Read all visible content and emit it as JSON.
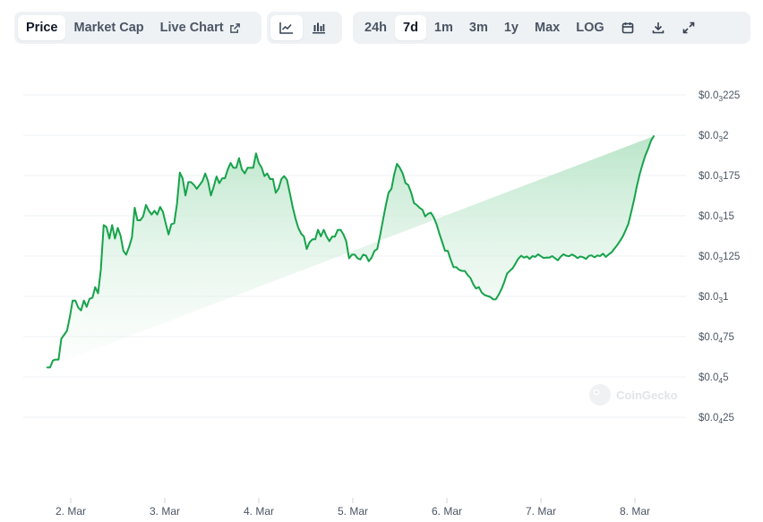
{
  "toolbar": {
    "metric_tabs": [
      {
        "label": "Price",
        "active": true
      },
      {
        "label": "Market Cap",
        "active": false
      },
      {
        "label": "Live Chart",
        "active": false
      }
    ],
    "chart_type_icons": [
      "line-chart-icon",
      "candlestick-chart-icon"
    ],
    "ranges": [
      {
        "label": "24h",
        "active": false
      },
      {
        "label": "7d",
        "active": true
      },
      {
        "label": "1m",
        "active": false
      },
      {
        "label": "3m",
        "active": false
      },
      {
        "label": "1y",
        "active": false
      },
      {
        "label": "Max",
        "active": false
      },
      {
        "label": "LOG",
        "active": false
      }
    ],
    "tool_icons": [
      "calendar-icon",
      "download-icon",
      "expand-icon"
    ]
  },
  "watermark": "CoinGecko",
  "colors": {
    "line": "#16a34a",
    "area_top": "#b7e4c7",
    "volume_bar": "#e5e7eb",
    "grid": "#eef0f3"
  },
  "chart_data": {
    "type": "area",
    "title": "",
    "xlabel": "",
    "ylabel": "",
    "y_ticks": [
      {
        "value": 2.25e-05,
        "prefix": "$0.0",
        "sub": "3",
        "digits": "225"
      },
      {
        "value": 2e-05,
        "prefix": "$0.0",
        "sub": "3",
        "digits": "2"
      },
      {
        "value": 1.75e-05,
        "prefix": "$0.0",
        "sub": "3",
        "digits": "175"
      },
      {
        "value": 1.5e-05,
        "prefix": "$0.0",
        "sub": "3",
        "digits": "15"
      },
      {
        "value": 1.25e-05,
        "prefix": "$0.0",
        "sub": "3",
        "digits": "125"
      },
      {
        "value": 1e-05,
        "prefix": "$0.0",
        "sub": "3",
        "digits": "1"
      },
      {
        "value": 7.5e-06,
        "prefix": "$0.0",
        "sub": "4",
        "digits": "75"
      },
      {
        "value": 5e-06,
        "prefix": "$0.0",
        "sub": "4",
        "digits": "5"
      },
      {
        "value": 2.5e-06,
        "prefix": "$0.0",
        "sub": "4",
        "digits": "25"
      }
    ],
    "ylim": [
      2.5e-06,
      2.25e-05
    ],
    "x_ticks": [
      "2. Mar",
      "3. Mar",
      "4. Mar",
      "5. Mar",
      "6. Mar",
      "7. Mar",
      "8. Mar"
    ],
    "grid": true,
    "price_series": {
      "x_days": [
        1.75,
        1.78,
        1.81,
        1.84,
        1.87,
        1.9,
        1.93,
        1.96,
        1.99,
        2.02,
        2.05,
        2.08,
        2.11,
        2.14,
        2.17,
        2.2,
        2.23,
        2.26,
        2.29,
        2.32,
        2.35,
        2.38,
        2.41,
        2.44,
        2.47,
        2.5,
        2.53,
        2.56,
        2.59,
        2.62,
        2.65,
        2.68,
        2.71,
        2.74,
        2.77,
        2.8,
        2.83,
        2.86,
        2.89,
        2.92,
        2.95,
        2.98,
        3.01,
        3.04,
        3.07,
        3.1,
        3.13,
        3.16,
        3.19,
        3.22,
        3.25,
        3.28,
        3.31,
        3.34,
        3.37,
        3.4,
        3.43,
        3.46,
        3.49,
        3.52,
        3.55,
        3.58,
        3.61,
        3.64,
        3.67,
        3.7,
        3.73,
        3.76,
        3.79,
        3.82,
        3.85,
        3.88,
        3.91,
        3.94,
        3.97,
        4.0,
        4.03,
        4.06,
        4.09,
        4.12,
        4.15,
        4.18,
        4.21,
        4.24,
        4.27,
        4.3,
        4.33,
        4.36,
        4.39,
        4.42,
        4.45,
        4.48,
        4.51,
        4.54,
        4.57,
        4.6,
        4.63,
        4.66,
        4.69,
        4.72,
        4.75,
        4.78,
        4.81,
        4.84,
        4.87,
        4.9,
        4.93,
        4.96,
        4.99,
        5.02,
        5.05,
        5.08,
        5.11,
        5.14,
        5.17,
        5.2,
        5.23,
        5.26,
        5.29,
        5.32,
        5.35,
        5.38,
        5.41,
        5.44,
        5.47,
        5.5,
        5.53,
        5.56,
        5.59,
        5.62,
        5.65,
        5.68,
        5.71,
        5.74,
        5.77,
        5.8,
        5.83,
        5.86,
        5.89,
        5.92,
        5.95,
        5.98,
        6.01,
        6.04,
        6.07,
        6.1,
        6.13,
        6.16,
        6.19,
        6.22,
        6.25,
        6.28,
        6.31,
        6.34,
        6.37,
        6.4,
        6.43,
        6.46,
        6.49,
        6.52,
        6.55,
        6.58,
        6.61,
        6.64,
        6.67,
        6.7,
        6.73,
        6.76,
        6.79,
        6.82,
        6.85,
        6.88,
        6.91,
        6.94,
        6.97,
        7.0,
        7.03,
        7.06,
        7.09,
        7.12,
        7.15,
        7.18,
        7.21,
        7.24,
        7.27,
        7.3,
        7.33,
        7.36,
        7.39,
        7.42,
        7.45,
        7.48,
        7.51,
        7.54,
        7.57,
        7.6,
        7.63,
        7.66,
        7.69,
        7.72,
        7.75,
        7.78,
        7.81,
        7.84,
        7.87,
        7.9,
        7.93,
        7.96,
        7.99,
        8.02,
        8.05,
        8.08,
        8.11,
        8.14,
        8.17,
        8.2,
        8.23,
        8.26,
        8.29,
        8.32,
        8.35,
        8.38,
        8.41,
        8.44,
        8.47,
        8.5
      ],
      "values": [
        5.59e-06,
        5.59e-06,
        6.02e-06,
        6.08e-06,
        6.08e-06,
        7.38e-06,
        7.61e-06,
        7.87e-06,
        8.72e-06,
        9.74e-06,
        9.74e-06,
        9.3e-06,
        9.13e-06,
        9.74e-06,
        9.35e-06,
        9.85e-06,
        9.91e-06,
        1.057e-05,
        1.019e-05,
        1.166e-05,
        1.442e-05,
        1.43e-05,
        1.359e-05,
        1.442e-05,
        1.359e-05,
        1.425e-05,
        1.377e-05,
        1.282e-05,
        1.259e-05,
        1.306e-05,
        1.365e-05,
        1.55e-05,
        1.472e-05,
        1.472e-05,
        1.496e-05,
        1.567e-05,
        1.531e-05,
        1.508e-05,
        1.531e-05,
        1.508e-05,
        1.555e-05,
        1.525e-05,
        1.454e-05,
        1.384e-05,
        1.448e-05,
        1.454e-05,
        1.573e-05,
        1.768e-05,
        1.733e-05,
        1.626e-05,
        1.709e-05,
        1.709e-05,
        1.691e-05,
        1.667e-05,
        1.691e-05,
        1.715e-05,
        1.762e-05,
        1.715e-05,
        1.626e-05,
        1.68e-05,
        1.744e-05,
        1.702e-05,
        1.733e-05,
        1.733e-05,
        1.787e-05,
        1.828e-05,
        1.798e-05,
        1.798e-05,
        1.858e-05,
        1.787e-05,
        1.763e-05,
        1.798e-05,
        1.798e-05,
        1.798e-05,
        1.887e-05,
        1.828e-05,
        1.798e-05,
        1.746e-05,
        1.763e-05,
        1.728e-05,
        1.728e-05,
        1.643e-05,
        1.669e-05,
        1.728e-05,
        1.746e-05,
        1.722e-05,
        1.639e-05,
        1.555e-05,
        1.484e-05,
        1.425e-05,
        1.389e-05,
        1.371e-05,
        1.294e-05,
        1.336e-05,
        1.354e-05,
        1.354e-05,
        1.413e-05,
        1.372e-05,
        1.413e-05,
        1.372e-05,
        1.342e-05,
        1.371e-05,
        1.371e-05,
        1.413e-05,
        1.413e-05,
        1.384e-05,
        1.342e-05,
        1.236e-05,
        1.259e-05,
        1.259e-05,
        1.236e-05,
        1.229e-05,
        1.259e-05,
        1.253e-05,
        1.218e-05,
        1.241e-05,
        1.282e-05,
        1.294e-05,
        1.377e-05,
        1.472e-05,
        1.561e-05,
        1.644e-05,
        1.667e-05,
        1.757e-05,
        1.822e-05,
        1.798e-05,
        1.762e-05,
        1.703e-05,
        1.691e-05,
        1.644e-05,
        1.579e-05,
        1.567e-05,
        1.549e-05,
        1.538e-05,
        1.496e-05,
        1.513e-05,
        1.519e-05,
        1.491e-05,
        1.449e-05,
        1.39e-05,
        1.336e-05,
        1.283e-05,
        1.283e-05,
        1.229e-05,
        1.181e-05,
        1.181e-05,
        1.165e-05,
        1.158e-05,
        1.158e-05,
        1.133e-05,
        1.114e-05,
        1.076e-05,
        1.049e-05,
        1.057e-05,
        1.024e-05,
        1.009e-05,
        1.002e-05,
        9.97e-06,
        9.82e-06,
        9.81e-06,
        1.01e-05,
        1.044e-05,
        1.089e-05,
        1.141e-05,
        1.159e-05,
        1.175e-05,
        1.204e-05,
        1.234e-05,
        1.252e-05,
        1.24e-05,
        1.248e-05,
        1.232e-05,
        1.25e-05,
        1.245e-05,
        1.261e-05,
        1.249e-05,
        1.238e-05,
        1.241e-05,
        1.24e-05,
        1.25e-05,
        1.236e-05,
        1.224e-05,
        1.246e-05,
        1.261e-05,
        1.252e-05,
        1.249e-05,
        1.26e-05,
        1.251e-05,
        1.237e-05,
        1.248e-05,
        1.242e-05,
        1.232e-05,
        1.251e-05,
        1.254e-05,
        1.242e-05,
        1.254e-05,
        1.25e-05,
        1.265e-05,
        1.245e-05,
        1.26e-05,
        1.272e-05,
        1.295e-05,
        1.316e-05,
        1.343e-05,
        1.371e-05,
        1.409e-05,
        1.449e-05,
        1.522e-05,
        1.598e-05,
        1.682e-05,
        1.758e-05,
        1.817e-05,
        1.872e-05,
        1.915e-05,
        1.965e-05,
        1.994e-05
      ],
      "__note": "x_days: 1.0 = 1. Mar; values in USD"
    },
    "volume_series": {
      "x_days": [],
      "values": []
    }
  }
}
